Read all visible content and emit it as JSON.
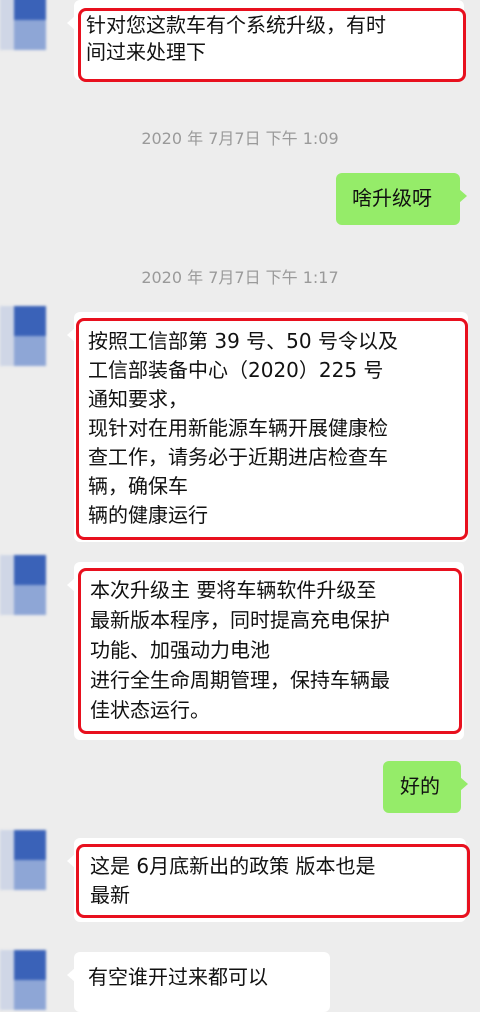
{
  "messages": [
    {
      "side": "left",
      "text": "针对您这款车有个系统升级，有时\n间过来处理下",
      "highlighted": true
    },
    {
      "type": "timestamp",
      "text": "2020 年 7月7日  下午 1:09"
    },
    {
      "side": "right",
      "text": "啥升级呀",
      "highlighted": false
    },
    {
      "type": "timestamp",
      "text": "2020 年 7月7日  下午 1:17"
    },
    {
      "side": "left",
      "text": "按照工信部第 39 号、50 号令以及\n工信部装备中心（2020）225 号\n通知要求，\n现针对在用新能源车辆开展健康检\n查工作，请务必于近期进店检查车\n辆，确保车\n辆的健康运行",
      "highlighted": true
    },
    {
      "side": "left",
      "text": "本次升级主  要将车辆软件升级至\n最新版本程序，同时提高充电保护\n功能、加强动力电池\n进行全生命周期管理，保持车辆最\n佳状态运行。",
      "highlighted": true
    },
    {
      "side": "right",
      "text": "好的",
      "highlighted": false
    },
    {
      "side": "left",
      "text": "这是 6月底新出的政策      版本也是\n最新",
      "highlighted": true
    },
    {
      "side": "left",
      "text": "有空谁开过来都可以",
      "highlighted": false
    }
  ],
  "colors": {
    "highlight": "#e8101e",
    "sent_bubble": "#95ec69",
    "received_bubble": "#ffffff",
    "background": "#ededed"
  }
}
